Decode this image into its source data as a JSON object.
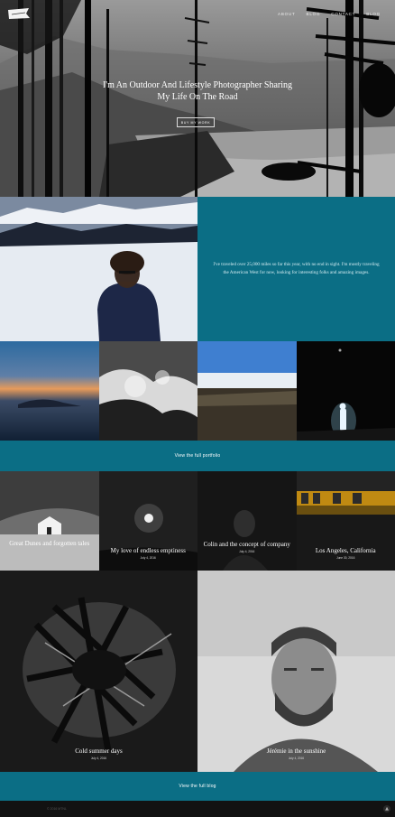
{
  "header": {
    "logo_alt": "logo",
    "nav": [
      "ABOUT",
      "BLOG",
      "CONTACT",
      "BLOG"
    ]
  },
  "hero": {
    "title": "I'm An Outdoor And Lifestyle Photographer Sharing My Life On The Road",
    "button": "BUY MY WORK"
  },
  "intro": {
    "text": "I've traveled over 25,000 miles so far this year, with no end in sight. I'm mostly traveling the American West for now, looking for interesting folks and amazing images."
  },
  "portfolio": {
    "link": "View the full portfolio"
  },
  "blog": {
    "posts": [
      {
        "title": "Great Dunes and forgotten tales",
        "date": ""
      },
      {
        "title": "My love of endless emptiness",
        "date": "July 4, 2016"
      },
      {
        "title": "Colin and the concept of company",
        "date": "July 4, 2016"
      },
      {
        "title": "Los Angeles, California",
        "date": "June 30, 2016"
      },
      {
        "title": "Cold summer days",
        "date": "July 4, 2016"
      },
      {
        "title": "Jérémie in the sunshine",
        "date": "July 4, 2016"
      }
    ],
    "link": "View the full blog"
  },
  "footer": {
    "copyright": "© 2016 MTNL",
    "top_icon": "arrow-up-icon"
  },
  "colors": {
    "accent_teal": "#0b6e85",
    "footer_bg": "#121212"
  }
}
